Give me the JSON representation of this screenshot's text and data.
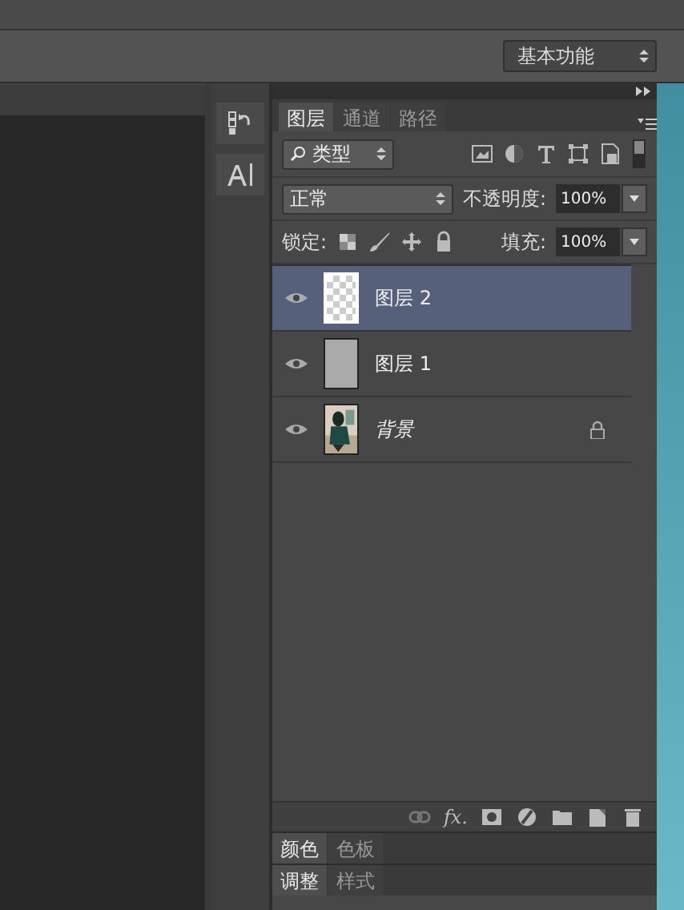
{
  "options_bar": {
    "workspace": "基本功能"
  },
  "panel_tabs": [
    {
      "label": "图层",
      "selected": true
    },
    {
      "label": "通道",
      "selected": false
    },
    {
      "label": "路径",
      "selected": false
    }
  ],
  "filter": {
    "value": "类型"
  },
  "blend": {
    "mode": "正常",
    "opacity_label": "不透明度:",
    "opacity": "100%"
  },
  "lock": {
    "label": "锁定:",
    "fill_label": "填充:",
    "fill": "100%"
  },
  "layers": [
    {
      "name": "图层 2",
      "selected": true,
      "visible": true,
      "kind": "transparent",
      "locked": false
    },
    {
      "name": "图层 1",
      "selected": false,
      "visible": true,
      "kind": "fill",
      "locked": false
    },
    {
      "name": "背景",
      "selected": false,
      "visible": true,
      "kind": "background",
      "locked": true
    }
  ],
  "footer": {
    "style_button": "fx."
  },
  "lower_tabs": [
    [
      {
        "label": "颜色",
        "selected": true
      },
      {
        "label": "色板",
        "selected": false
      }
    ],
    [
      {
        "label": "调整",
        "selected": true
      },
      {
        "label": "样式",
        "selected": false
      }
    ]
  ]
}
